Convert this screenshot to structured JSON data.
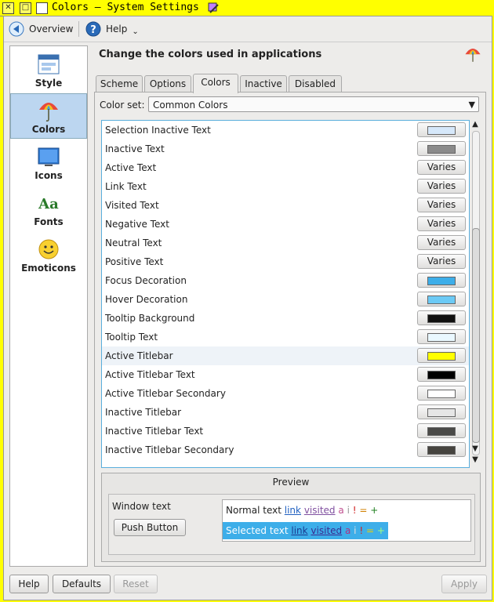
{
  "window": {
    "title": "Colors – System Settings"
  },
  "toolbar": {
    "overview_label": "Overview",
    "help_label": "Help"
  },
  "sidebar": {
    "items": [
      {
        "label": "Style",
        "icon": "style-icon"
      },
      {
        "label": "Colors",
        "icon": "umbrella-icon",
        "selected": true
      },
      {
        "label": "Icons",
        "icon": "monitor-icon"
      },
      {
        "label": "Fonts",
        "icon": "fonts-icon"
      },
      {
        "label": "Emoticons",
        "icon": "smiley-icon"
      }
    ]
  },
  "main": {
    "heading": "Change the colors used in applications",
    "tabs": [
      {
        "label": "Scheme"
      },
      {
        "label": "Options"
      },
      {
        "label": "Colors",
        "active": true
      },
      {
        "label": "Inactive"
      },
      {
        "label": "Disabled"
      }
    ],
    "color_set_label": "Color set:",
    "color_set_value": "Common Colors",
    "color_rows": [
      {
        "label": "Selection Inactive Text",
        "color": "#d6e8fa",
        "varies": false
      },
      {
        "label": "Inactive Text",
        "color": "#8a8a8a",
        "varies": false
      },
      {
        "label": "Active Text",
        "varies": true,
        "button_label": "Varies"
      },
      {
        "label": "Link Text",
        "varies": true,
        "button_label": "Varies"
      },
      {
        "label": "Visited Text",
        "varies": true,
        "button_label": "Varies"
      },
      {
        "label": "Negative Text",
        "varies": true,
        "button_label": "Varies"
      },
      {
        "label": "Neutral Text",
        "varies": true,
        "button_label": "Varies"
      },
      {
        "label": "Positive Text",
        "varies": true,
        "button_label": "Varies"
      },
      {
        "label": "Focus Decoration",
        "color": "#3daee9",
        "varies": false
      },
      {
        "label": "Hover Decoration",
        "color": "#6ccaf5",
        "varies": false
      },
      {
        "label": "Tooltip Background",
        "color": "#111111",
        "varies": false
      },
      {
        "label": "Tooltip Text",
        "color": "#eaf8ff",
        "varies": false
      },
      {
        "label": "Active Titlebar",
        "color": "#ffff00",
        "varies": false,
        "highlighted": true
      },
      {
        "label": "Active Titlebar Text",
        "color": "#000000",
        "varies": false
      },
      {
        "label": "Active Titlebar Secondary",
        "color": "#ffffff",
        "varies": false
      },
      {
        "label": "Inactive Titlebar",
        "color": "#e6e6e6",
        "varies": false
      },
      {
        "label": "Inactive Titlebar Text",
        "color": "#4a4a48",
        "varies": false
      },
      {
        "label": "Inactive Titlebar Secondary",
        "color": "#46443f",
        "varies": false
      }
    ],
    "preview": {
      "title": "Preview",
      "window_text": "Window text",
      "push_button": "Push Button",
      "normal_text": "Normal text",
      "selected_text": "Selected text",
      "link": "link",
      "visited": "visited",
      "active_a": "a",
      "inactive_i": "i",
      "negative": "!",
      "neutral": "=",
      "positive": "+"
    }
  },
  "bottom": {
    "help_label": "Help",
    "defaults_label": "Defaults",
    "reset_label": "Reset",
    "apply_label": "Apply"
  },
  "colors": {
    "titlebar": "#ffff00",
    "selection": "#3daee9",
    "focus_border": "#5aaedc"
  }
}
